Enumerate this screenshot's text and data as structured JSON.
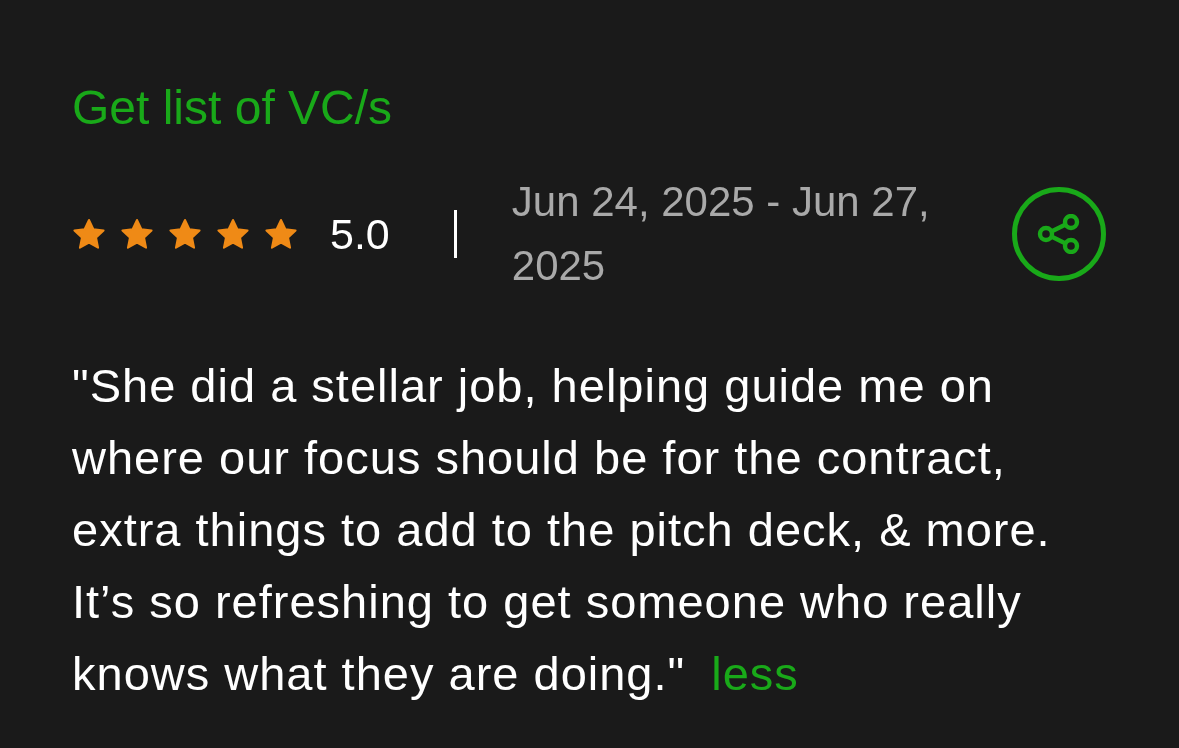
{
  "task": {
    "title": "Get list of VC/s"
  },
  "rating": {
    "stars": 5,
    "score": "5.0"
  },
  "date_range": "Jun 24, 2025 - Jun 27, 2025",
  "review": {
    "text": "\"She did a stellar job, helping guide me on where our focus should be for the contract, extra things to add to the pitch deck, & more. It’s so refreshing to get someone who really knows what they are doing.\"",
    "toggle": "less"
  }
}
